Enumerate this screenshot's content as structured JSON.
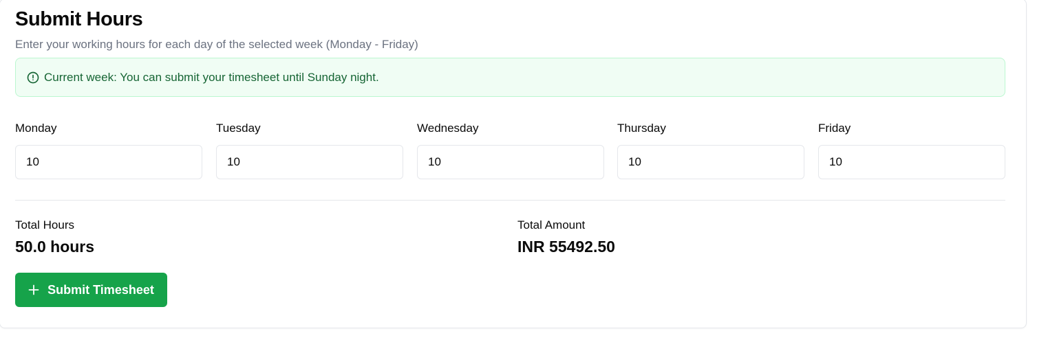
{
  "header": {
    "title": "Submit Hours",
    "subtitle": "Enter your working hours for each day of the selected week (Monday - Friday)"
  },
  "alert": {
    "icon": "alert-circle-icon",
    "text": "Current week: You can submit your timesheet until Sunday night."
  },
  "days": [
    {
      "label": "Monday",
      "value": "10"
    },
    {
      "label": "Tuesday",
      "value": "10"
    },
    {
      "label": "Wednesday",
      "value": "10"
    },
    {
      "label": "Thursday",
      "value": "10"
    },
    {
      "label": "Friday",
      "value": "10"
    }
  ],
  "totals": {
    "hours_label": "Total Hours",
    "hours_value": "50.0 hours",
    "amount_label": "Total Amount",
    "amount_value": "INR 55492.50"
  },
  "submit": {
    "icon": "plus-icon",
    "label": "Submit Timesheet"
  },
  "colors": {
    "accent": "#16a34a",
    "alert_bg": "#f0fdf4",
    "alert_border": "#bbf7d0",
    "alert_text": "#166534",
    "muted_text": "#6b7280"
  }
}
